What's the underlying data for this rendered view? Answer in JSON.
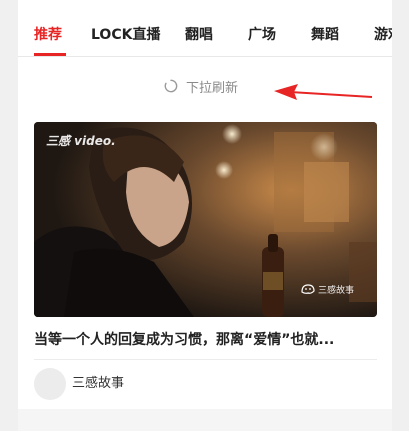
{
  "tabs": [
    {
      "label": "推荐",
      "active": true
    },
    {
      "label": "LOCK直播",
      "active": false
    },
    {
      "label": "翻唱",
      "active": false
    },
    {
      "label": "广场",
      "active": false
    },
    {
      "label": "舞蹈",
      "active": false
    },
    {
      "label": "游戏",
      "active": false
    }
  ],
  "refresh": {
    "icon": "loading-spinner-icon",
    "label": "下拉刷新"
  },
  "annotation": {
    "icon": "red-arrow-icon",
    "color": "#e82525"
  },
  "card": {
    "thumbnail_watermark_top": "三感 video.",
    "thumbnail_watermark_bottom": "三感故事",
    "title": "当等一个人的回复成为习惯，那离“爱情”也就...",
    "author": "三感故事"
  },
  "colors": {
    "accent": "#e82525",
    "text": "#222222",
    "muted": "#8a8a8a"
  }
}
